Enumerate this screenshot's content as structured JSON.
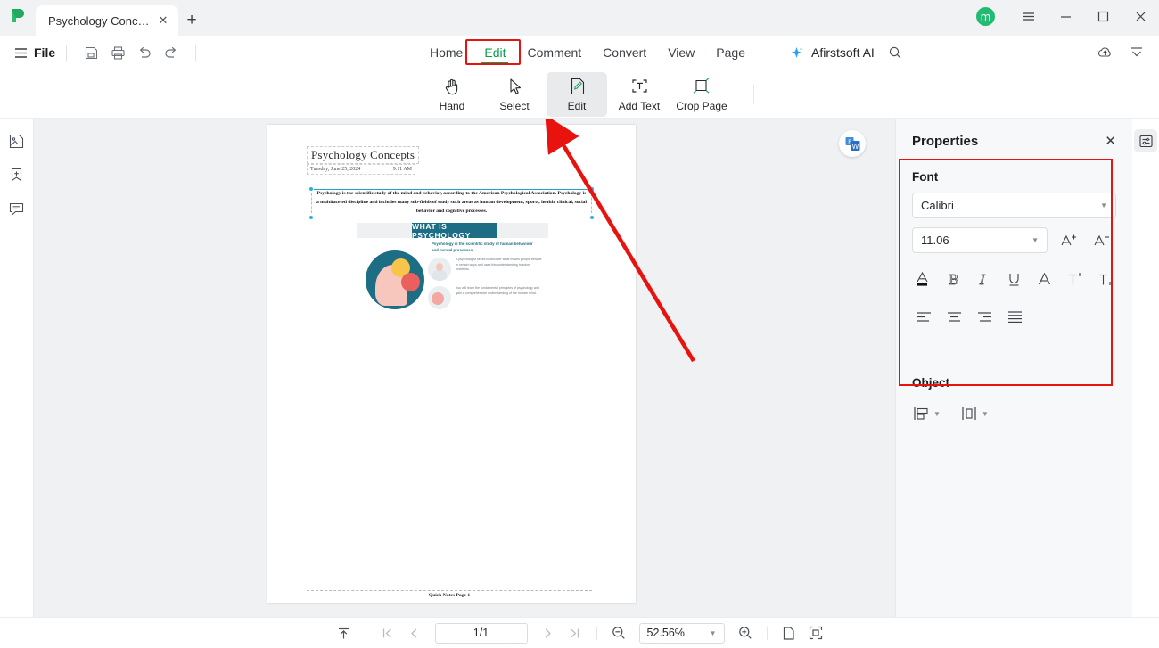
{
  "titlebar": {
    "logo_icon": "app-logo-green-p",
    "tab_title": "Psychology Concepts ...",
    "tab_close_icon": "close-icon",
    "new_tab_icon": "plus-icon",
    "avatar_initial": "m",
    "menu_icon": "hamburger-menu-icon",
    "minimize_icon": "minimize-icon",
    "maximize_icon": "maximize-icon",
    "close_icon": "close-icon"
  },
  "menurow": {
    "file_label": "File",
    "file_icon": "hamburger-icon",
    "quick_icons": [
      "save-icon",
      "print-icon",
      "undo-icon",
      "redo-icon"
    ],
    "tabs": [
      {
        "label": "Home",
        "active": false
      },
      {
        "label": "Edit",
        "active": true
      },
      {
        "label": "Comment",
        "active": false
      },
      {
        "label": "Convert",
        "active": false
      },
      {
        "label": "View",
        "active": false
      },
      {
        "label": "Page",
        "active": false
      }
    ],
    "ai_label": "Afirstsoft AI",
    "ai_icon": "sparkle-icon",
    "search_icon": "search-icon",
    "cloud_icon": "cloud-upload-icon",
    "collapse_icon": "collapse-ribbon-icon"
  },
  "ribbon": {
    "tools": [
      {
        "label": "Hand",
        "icon": "hand-icon",
        "selected": false
      },
      {
        "label": "Select",
        "icon": "cursor-icon",
        "selected": false
      },
      {
        "label": "Edit",
        "icon": "edit-page-icon",
        "selected": true
      },
      {
        "label": "Add Text",
        "icon": "add-text-icon",
        "selected": false
      },
      {
        "label": "Crop Page",
        "icon": "crop-page-icon",
        "selected": false
      }
    ]
  },
  "leftrail": {
    "items": [
      {
        "icon": "thumbnails-icon"
      },
      {
        "icon": "bookmark-add-icon"
      },
      {
        "icon": "comment-icon"
      }
    ]
  },
  "document": {
    "title": "Psychology Concepts",
    "meta_date": "Tuesday, June 25, 2024",
    "meta_time": "9:11 AM",
    "selected_paragraph": "Psychology is the scientific study of the mind and behavior, according to the American Psychological Association. Psychology is a multifaceted discipline and includes many sub-fields of study such areas as human development, sports, health, clinical, social behavior and cognitive processes.",
    "infographic_title": "WHAT IS PSYCHOLOGY",
    "infographic_lead": "Psychology is the scientific study of human behaviour and mental processes.",
    "infographic_p1": "A psychologist seeks to discover what makes people behave in certain ways and uses this understanding to solve problems.",
    "infographic_p2": "You will learn the fundamental principles of psychology and gain a comprehensive understanding of the human mind.",
    "footer": "Quick Notes Page 1",
    "convert_badge_icon": "pdf-to-word-icon"
  },
  "properties": {
    "panel_title": "Properties",
    "close_icon": "close-icon",
    "font_section_label": "Font",
    "font_family": "Calibri",
    "font_size": "11.06",
    "increase_size_icon": "increase-font-size-icon",
    "decrease_size_icon": "decrease-font-size-icon",
    "format_buttons": [
      {
        "icon": "font-color-icon",
        "label": "A"
      },
      {
        "icon": "bold-icon",
        "label": "B"
      },
      {
        "icon": "italic-icon",
        "label": "I"
      },
      {
        "icon": "underline-icon",
        "label": "U"
      },
      {
        "icon": "strikethrough-icon",
        "label": "A"
      },
      {
        "icon": "superscript-icon",
        "label": "T"
      },
      {
        "icon": "subscript-icon",
        "label": "T"
      }
    ],
    "align_buttons": [
      {
        "icon": "align-left-icon"
      },
      {
        "icon": "align-center-icon"
      },
      {
        "icon": "align-right-icon"
      },
      {
        "icon": "align-justify-icon"
      }
    ],
    "object_section_label": "Object",
    "object_buttons": [
      {
        "icon": "align-objects-icon"
      },
      {
        "icon": "distribute-objects-icon"
      }
    ],
    "panel_toggle_icon": "properties-panel-icon",
    "highlight_color": "#e8130f"
  },
  "statusbar": {
    "fit_top_icon": "scroll-to-top-icon",
    "first_page_icon": "first-page-icon",
    "prev_page_icon": "prev-page-icon",
    "page_value": "1/1",
    "next_page_icon": "next-page-icon",
    "last_page_icon": "last-page-icon",
    "zoom_out_icon": "zoom-out-icon",
    "zoom_value": "52.56%",
    "zoom_in_icon": "zoom-in-icon",
    "single_page_icon": "single-page-icon",
    "fit_page_icon": "fit-page-icon"
  },
  "colors": {
    "accent_green": "#0c9d4e",
    "annotation_red": "#e8130f",
    "teal": "#1d6e85",
    "selection_blue": "#2bb3e0"
  }
}
